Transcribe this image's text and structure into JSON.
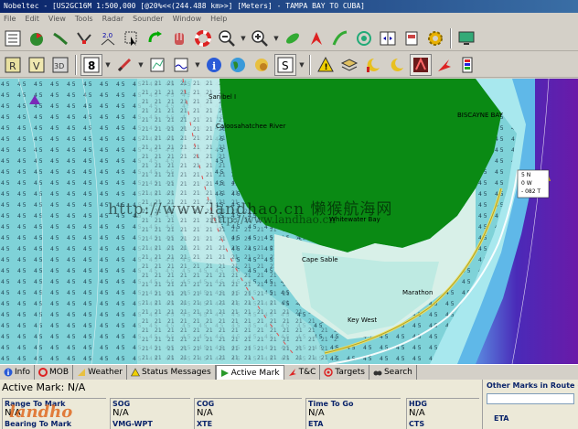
{
  "window": {
    "title": "Nobeltec - [US2GC16M 1:500,000 [@20%<<(244.488 km>>] [Meters] - TAMPA BAY TO CUBA]"
  },
  "menu": [
    "File",
    "Edit",
    "View",
    "Tools",
    "Radar",
    "Sounder",
    "Window",
    "Help"
  ],
  "toolbar2": {
    "layers_number": "8"
  },
  "map": {
    "labels": [
      "Sanibel I",
      "Caloosahatchee River",
      "Whitewater Bay",
      "Cape Sable",
      "Key West",
      "Marathon",
      "BISCAYNE BAY"
    ],
    "watermark": "http://www.landhao.cn 懒猴航海网",
    "watermark2": "http://www.landhao.cn",
    "callout": [
      "5 N",
      "0 W",
      "- 082 T"
    ]
  },
  "tabs": [
    "Info",
    "MOB",
    "Weather",
    "Status Messages",
    "Active Mark",
    "T&C",
    "Targets",
    "Search"
  ],
  "active_tab": "Active Mark",
  "panel": {
    "active_mark": "Active Mark: N/A",
    "fields": [
      {
        "label": "Range To Mark",
        "value": "N/A"
      },
      {
        "label": "SOG",
        "value": "N/A"
      },
      {
        "label": "COG",
        "value": "N/A"
      },
      {
        "label": "Time To Go",
        "value": "N/A"
      },
      {
        "label": "HDG",
        "value": "N/A"
      }
    ],
    "fields_row2": [
      "Bearing To Mark",
      "VMG-WPT",
      "XTE",
      "ETA",
      "CTS"
    ],
    "other_marks_title": "Other Marks in Route (T",
    "eta_label": "ETA"
  },
  "logo_text": "landhao"
}
